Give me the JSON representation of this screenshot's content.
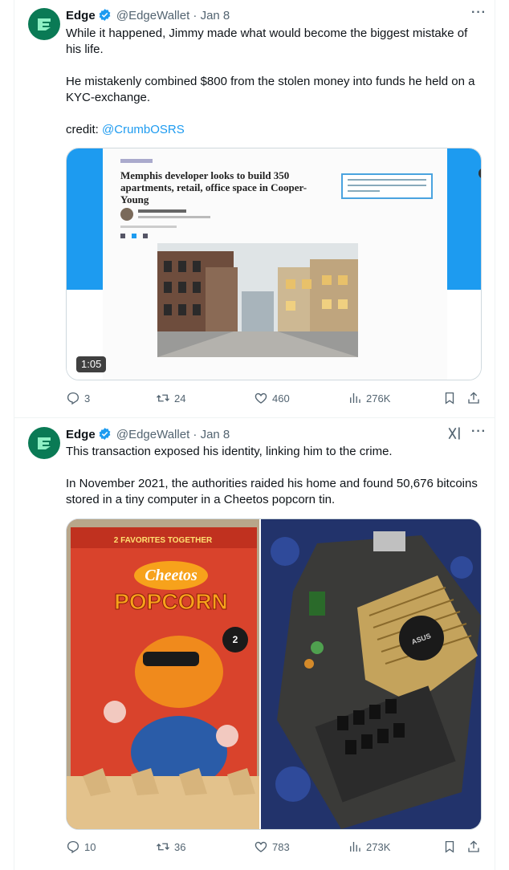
{
  "tweets": [
    {
      "author_name": "Edge",
      "handle": "@EdgeWallet",
      "date": "· Jan 8",
      "text_p1": "While it happened, Jimmy made what would become the biggest mistake of his life.",
      "text_p2": "He mistakenly combined $800 from the stolen money into funds he held on a KYC-exchange.",
      "credit_label": "credit: ",
      "credit_link": "@CrumbOSRS",
      "video": {
        "duration": "1:05",
        "headline": "Memphis developer looks to build 350 apartments, retail, office space in Cooper-Young"
      },
      "stats": {
        "replies": "3",
        "reposts": "24",
        "likes": "460",
        "views": "276K"
      }
    },
    {
      "author_name": "Edge",
      "handle": "@EdgeWallet",
      "date": "· Jan 8",
      "text_p1": "This transaction exposed his identity, linking him to the crime.",
      "text_p2": "In November 2021, the authorities raided his home and found 50,676 bitcoins stored in a tiny computer in a Cheetos popcorn tin.",
      "photos": {
        "tin_band": "2 FAVORITES TOGETHER",
        "tin_brand": "Cheetos",
        "tin_product": "POPCORN",
        "board_brand": "ASUS"
      },
      "stats": {
        "replies": "10",
        "reposts": "36",
        "likes": "783",
        "views": "273K"
      }
    }
  ],
  "icons": {
    "more": "more-dots-icon",
    "verified": "verified-badge-icon",
    "grok": "grok-icon",
    "reply": "reply-icon",
    "repost": "repost-icon",
    "like": "heart-icon",
    "views": "views-chart-icon",
    "bookmark": "bookmark-icon",
    "share": "share-icon"
  },
  "colors": {
    "accent": "#1d9bf0",
    "avatar_bg": "#0a7a55",
    "secondary_text": "#536471"
  }
}
